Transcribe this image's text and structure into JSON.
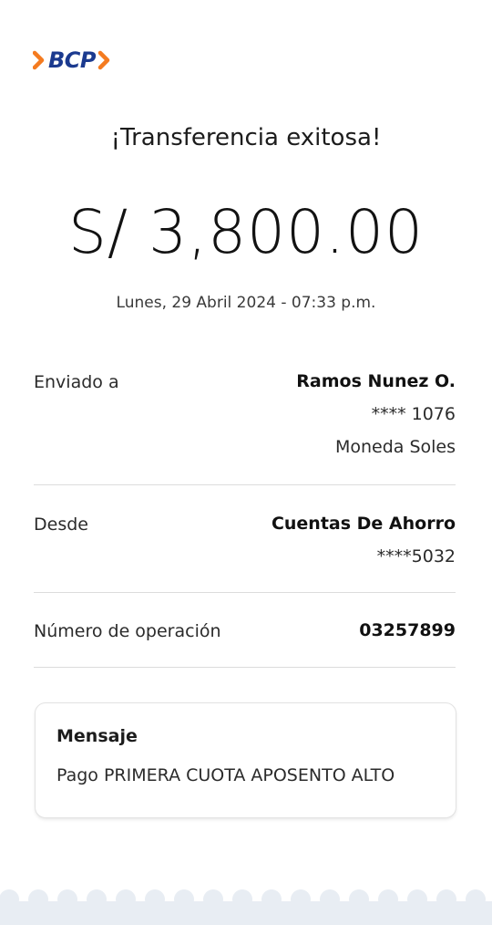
{
  "brand": {
    "logo_text": "BCP",
    "primary_color": "#1b3a8f",
    "accent_color": "#f47b20"
  },
  "receipt": {
    "title": "¡Transferencia exitosa!",
    "amount": "S/ 3,800.00",
    "datetime": "Lunes, 29 Abril 2024 - 07:33 p.m."
  },
  "details": {
    "sent_to": {
      "label": "Enviado a",
      "name": "Ramos Nunez O.",
      "account": "**** 1076",
      "currency": "Moneda Soles"
    },
    "from": {
      "label": "Desde",
      "account_type": "Cuentas De Ahorro",
      "account": "****5032"
    },
    "operation": {
      "label": "Número de operación",
      "number": "03257899"
    }
  },
  "message": {
    "title": "Mensaje",
    "text": "Pago PRIMERA CUOTA APOSENTO ALTO"
  },
  "footer": {
    "edge_color": "#e8edf3"
  }
}
